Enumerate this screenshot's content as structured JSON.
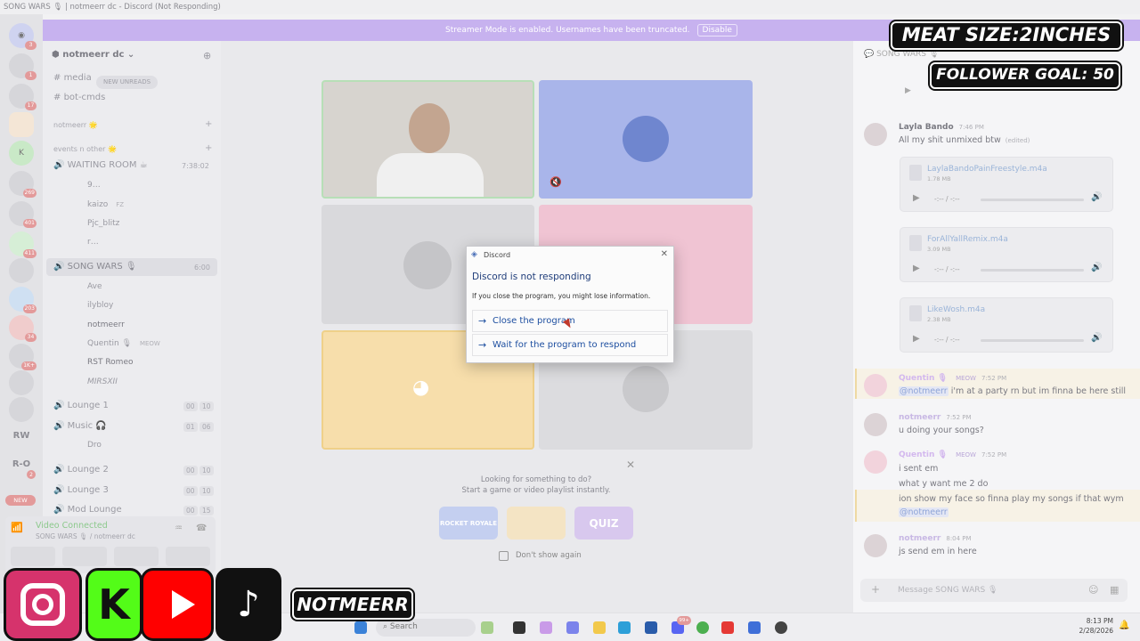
{
  "window_title": "SONG WARS 🎙 | notmeerr dc - Discord (Not Responding)",
  "streamer_banner": {
    "text": "Streamer Mode is enabled. Usernames have been truncated.",
    "button": "Disable"
  },
  "guilds": {
    "badges": [
      "3",
      "1",
      "17",
      "269",
      "401",
      "411",
      "203",
      "34",
      "1K+",
      "2"
    ],
    "text_items": [
      "RW",
      "R-O"
    ],
    "new_label": "NEW"
  },
  "server": {
    "name": "notmeerr dc",
    "new_unreads": "NEW UNREADS",
    "channels_top": [
      "media",
      "bot-cmds"
    ],
    "categories": [
      "notmeerr 🌟",
      "events n other 🌟"
    ],
    "waiting_room": {
      "name": "WAITING ROOM ☕",
      "time": "7:38:02",
      "members": [
        "9…",
        "kaizo",
        "Pjc_blitz",
        "r…"
      ],
      "kaizo_tag": "FZ"
    },
    "song_wars": {
      "name": "SONG WARS 🎙",
      "time": "6:00",
      "members": [
        "Ave",
        "ilybloy",
        "notmeerr",
        "Quentin 🎙",
        "RST Romeo",
        "MIRSXII"
      ],
      "quentin_tag": "MEOW"
    },
    "voice_channels": [
      {
        "name": "Lounge 1",
        "a": "00",
        "b": "10"
      },
      {
        "name": "Music 🎧",
        "a": "01",
        "b": "06"
      },
      {
        "name": "Lounge 2",
        "a": "00",
        "b": "10"
      },
      {
        "name": "Lounge 3",
        "a": "00",
        "b": "10"
      },
      {
        "name": "Mod Lounge",
        "a": "00",
        "b": "15"
      }
    ],
    "music_member": "Dro"
  },
  "voice_status": {
    "title": "Video Connected",
    "sub": "SONG WARS 🎙 / notmeerr dc"
  },
  "activity": {
    "line1": "Looking for something to do?",
    "line2": "Start a game or video playlist instantly.",
    "games": [
      "ROCKET ROYALE",
      "",
      "QUIZ"
    ],
    "dont_show": "Don't show again"
  },
  "dialog": {
    "title": "Discord",
    "heading": "Discord is not responding",
    "body": "If you close the program, you might lose information.",
    "option1": "Close the program",
    "option2": "Wait for the program to respond"
  },
  "chat": {
    "channel": "SONG WARS 🎙",
    "messages": [
      {
        "name": "Layla Bando",
        "time": "7:46 PM",
        "text": "All my shit unmixed btw",
        "edited": "(edited)"
      },
      {
        "name": "Quentin 🎙",
        "tag": "MEOW",
        "time": "7:52 PM",
        "text": "i'm at a party rn but im finna be here still",
        "mention": "@notmeerr"
      },
      {
        "name": "notmeerr",
        "time": "7:52 PM",
        "text": "u doing your songs?"
      },
      {
        "name": "Quentin 🎙",
        "tag": "MEOW",
        "time": "7:52 PM",
        "lines": [
          "i sent em",
          "what y want me 2 do",
          "ion show my face so finna play my songs if that wym"
        ],
        "mention": "@notmeerr"
      },
      {
        "name": "notmeerr",
        "time": "8:04 PM",
        "text": "js send em in here"
      }
    ],
    "attachments": [
      {
        "file": "LaylaBandoPainFreestyle.m4a",
        "size": "1.78 MB",
        "time": "-:-- / -:--"
      },
      {
        "file": "ForAllYallRemix.m4a",
        "size": "3.09 MB",
        "time": "-:-- / -:--"
      },
      {
        "file": "LikeWosh.m4a",
        "size": "2.38 MB",
        "time": "-:-- / -:--"
      }
    ],
    "compose_placeholder": "Message SONG WARS 🎙"
  },
  "overlay": {
    "meat": "MEAT SIZE:2INCHES",
    "goal": "FOLLOWER GOAL: 50",
    "handle": "NOTMEERR"
  },
  "taskbar": {
    "search": "Search",
    "time": "8:13 PM",
    "date": "2/28/2026",
    "badge": "99+"
  }
}
